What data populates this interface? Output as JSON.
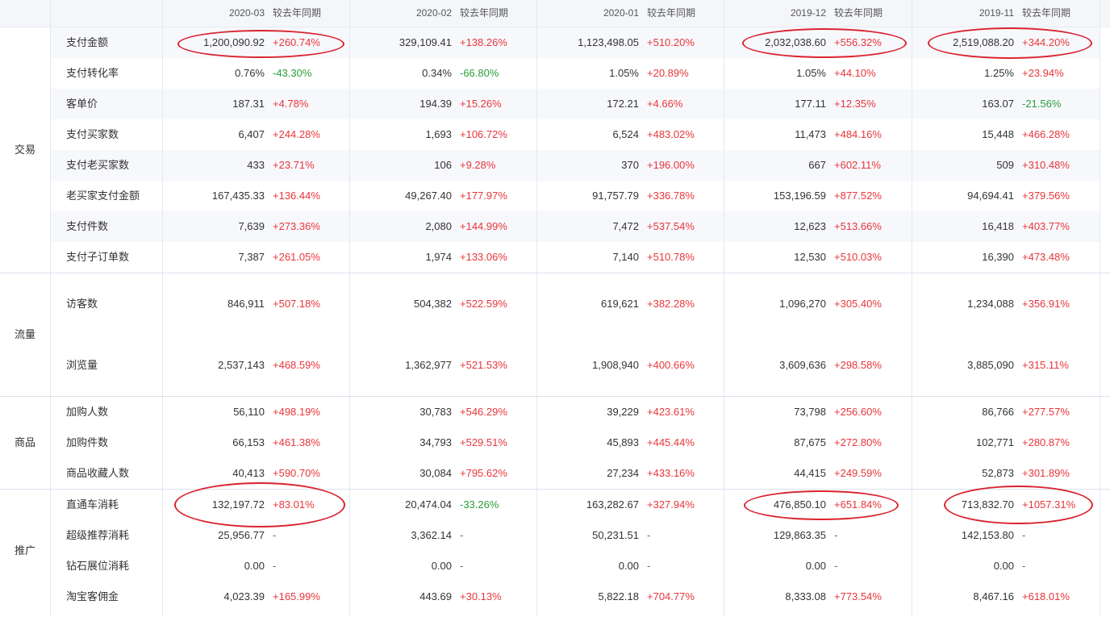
{
  "header": {
    "months": [
      "2020-03",
      "2020-02",
      "2020-01",
      "2019-12",
      "2019-11"
    ],
    "compare_label": "较去年同期"
  },
  "sections": [
    {
      "name": "交易",
      "rows": [
        {
          "metric": "支付金额",
          "cells": [
            [
              "1,200,090.92",
              "+260.74%"
            ],
            [
              "329,109.41",
              "+138.26%"
            ],
            [
              "1,123,498.05",
              "+510.20%"
            ],
            [
              "2,032,038.60",
              "+556.32%"
            ],
            [
              "2,519,088.20",
              "+344.20%"
            ]
          ]
        },
        {
          "metric": "支付转化率",
          "cells": [
            [
              "0.76%",
              "-43.30%"
            ],
            [
              "0.34%",
              "-66.80%"
            ],
            [
              "1.05%",
              "+20.89%"
            ],
            [
              "1.05%",
              "+44.10%"
            ],
            [
              "1.25%",
              "+23.94%"
            ]
          ]
        },
        {
          "metric": "客单价",
          "cells": [
            [
              "187.31",
              "+4.78%"
            ],
            [
              "194.39",
              "+15.26%"
            ],
            [
              "172.21",
              "+4.66%"
            ],
            [
              "177.11",
              "+12.35%"
            ],
            [
              "163.07",
              "-21.56%"
            ]
          ]
        },
        {
          "metric": "支付买家数",
          "cells": [
            [
              "6,407",
              "+244.28%"
            ],
            [
              "1,693",
              "+106.72%"
            ],
            [
              "6,524",
              "+483.02%"
            ],
            [
              "11,473",
              "+484.16%"
            ],
            [
              "15,448",
              "+466.28%"
            ]
          ]
        },
        {
          "metric": "支付老买家数",
          "cells": [
            [
              "433",
              "+23.71%"
            ],
            [
              "106",
              "+9.28%"
            ],
            [
              "370",
              "+196.00%"
            ],
            [
              "667",
              "+602.11%"
            ],
            [
              "509",
              "+310.48%"
            ]
          ]
        },
        {
          "metric": "老买家支付金额",
          "cells": [
            [
              "167,435.33",
              "+136.44%"
            ],
            [
              "49,267.40",
              "+177.97%"
            ],
            [
              "91,757.79",
              "+336.78%"
            ],
            [
              "153,196.59",
              "+877.52%"
            ],
            [
              "94,694.41",
              "+379.56%"
            ]
          ]
        },
        {
          "metric": "支付件数",
          "cells": [
            [
              "7,639",
              "+273.36%"
            ],
            [
              "2,080",
              "+144.99%"
            ],
            [
              "7,472",
              "+537.54%"
            ],
            [
              "12,623",
              "+513.66%"
            ],
            [
              "16,418",
              "+403.77%"
            ]
          ]
        },
        {
          "metric": "支付子订单数",
          "cells": [
            [
              "7,387",
              "+261.05%"
            ],
            [
              "1,974",
              "+133.06%"
            ],
            [
              "7,140",
              "+510.78%"
            ],
            [
              "12,530",
              "+510.03%"
            ],
            [
              "16,390",
              "+473.48%"
            ]
          ]
        }
      ]
    },
    {
      "name": "流量",
      "rows": [
        {
          "metric": "访客数",
          "cells": [
            [
              "846,911",
              "+507.18%"
            ],
            [
              "504,382",
              "+522.59%"
            ],
            [
              "619,621",
              "+382.28%"
            ],
            [
              "1,096,270",
              "+305.40%"
            ],
            [
              "1,234,088",
              "+356.91%"
            ]
          ]
        },
        {
          "metric": "浏览量",
          "cells": [
            [
              "2,537,143",
              "+468.59%"
            ],
            [
              "1,362,977",
              "+521.53%"
            ],
            [
              "1,908,940",
              "+400.66%"
            ],
            [
              "3,609,636",
              "+298.58%"
            ],
            [
              "3,885,090",
              "+315.11%"
            ]
          ]
        }
      ]
    },
    {
      "name": "商品",
      "rows": [
        {
          "metric": "加购人数",
          "cells": [
            [
              "56,110",
              "+498.19%"
            ],
            [
              "30,783",
              "+546.29%"
            ],
            [
              "39,229",
              "+423.61%"
            ],
            [
              "73,798",
              "+256.60%"
            ],
            [
              "86,766",
              "+277.57%"
            ]
          ]
        },
        {
          "metric": "加购件数",
          "cells": [
            [
              "66,153",
              "+461.38%"
            ],
            [
              "34,793",
              "+529.51%"
            ],
            [
              "45,893",
              "+445.44%"
            ],
            [
              "87,675",
              "+272.80%"
            ],
            [
              "102,771",
              "+280.87%"
            ]
          ]
        },
        {
          "metric": "商品收藏人数",
          "cells": [
            [
              "40,413",
              "+590.70%"
            ],
            [
              "30,084",
              "+795.62%"
            ],
            [
              "27,234",
              "+433.16%"
            ],
            [
              "44,415",
              "+249.59%"
            ],
            [
              "52,873",
              "+301.89%"
            ]
          ]
        }
      ]
    },
    {
      "name": "推广",
      "rows": [
        {
          "metric": "直通车消耗",
          "cells": [
            [
              "132,197.72",
              "+83.01%"
            ],
            [
              "20,474.04",
              "-33.26%"
            ],
            [
              "163,282.67",
              "+327.94%"
            ],
            [
              "476,850.10",
              "+651.84%"
            ],
            [
              "713,832.70",
              "+1057.31%"
            ]
          ]
        },
        {
          "metric": "超级推荐消耗",
          "cells": [
            [
              "25,956.77",
              "-"
            ],
            [
              "3,362.14",
              "-"
            ],
            [
              "50,231.51",
              "-"
            ],
            [
              "129,863.35",
              "-"
            ],
            [
              "142,153.80",
              "-"
            ]
          ]
        },
        {
          "metric": "钻石展位消耗",
          "cells": [
            [
              "0.00",
              "-"
            ],
            [
              "0.00",
              "-"
            ],
            [
              "0.00",
              "-"
            ],
            [
              "0.00",
              "-"
            ],
            [
              "0.00",
              "-"
            ]
          ]
        },
        {
          "metric": "淘宝客佣金",
          "cells": [
            [
              "4,023.39",
              "+165.99%"
            ],
            [
              "443.69",
              "+30.13%"
            ],
            [
              "5,822.18",
              "+704.77%"
            ],
            [
              "8,333.08",
              "+773.54%"
            ],
            [
              "8,467.16",
              "+618.01%"
            ]
          ]
        }
      ]
    }
  ],
  "highlights": [
    {
      "metric": "支付金额",
      "month": "2020-03"
    },
    {
      "metric": "支付金额",
      "month": "2019-12"
    },
    {
      "metric": "支付金额",
      "month": "2019-11"
    },
    {
      "metric": "直通车消耗",
      "month": "2020-03"
    },
    {
      "metric": "直通车消耗",
      "month": "2019-12"
    },
    {
      "metric": "直通车消耗",
      "month": "2019-11"
    }
  ],
  "colors": {
    "increase": "#e8363b",
    "decrease": "#2a9d3a",
    "annotation": "#d9232e",
    "header_bg": "#f4f6fa"
  }
}
